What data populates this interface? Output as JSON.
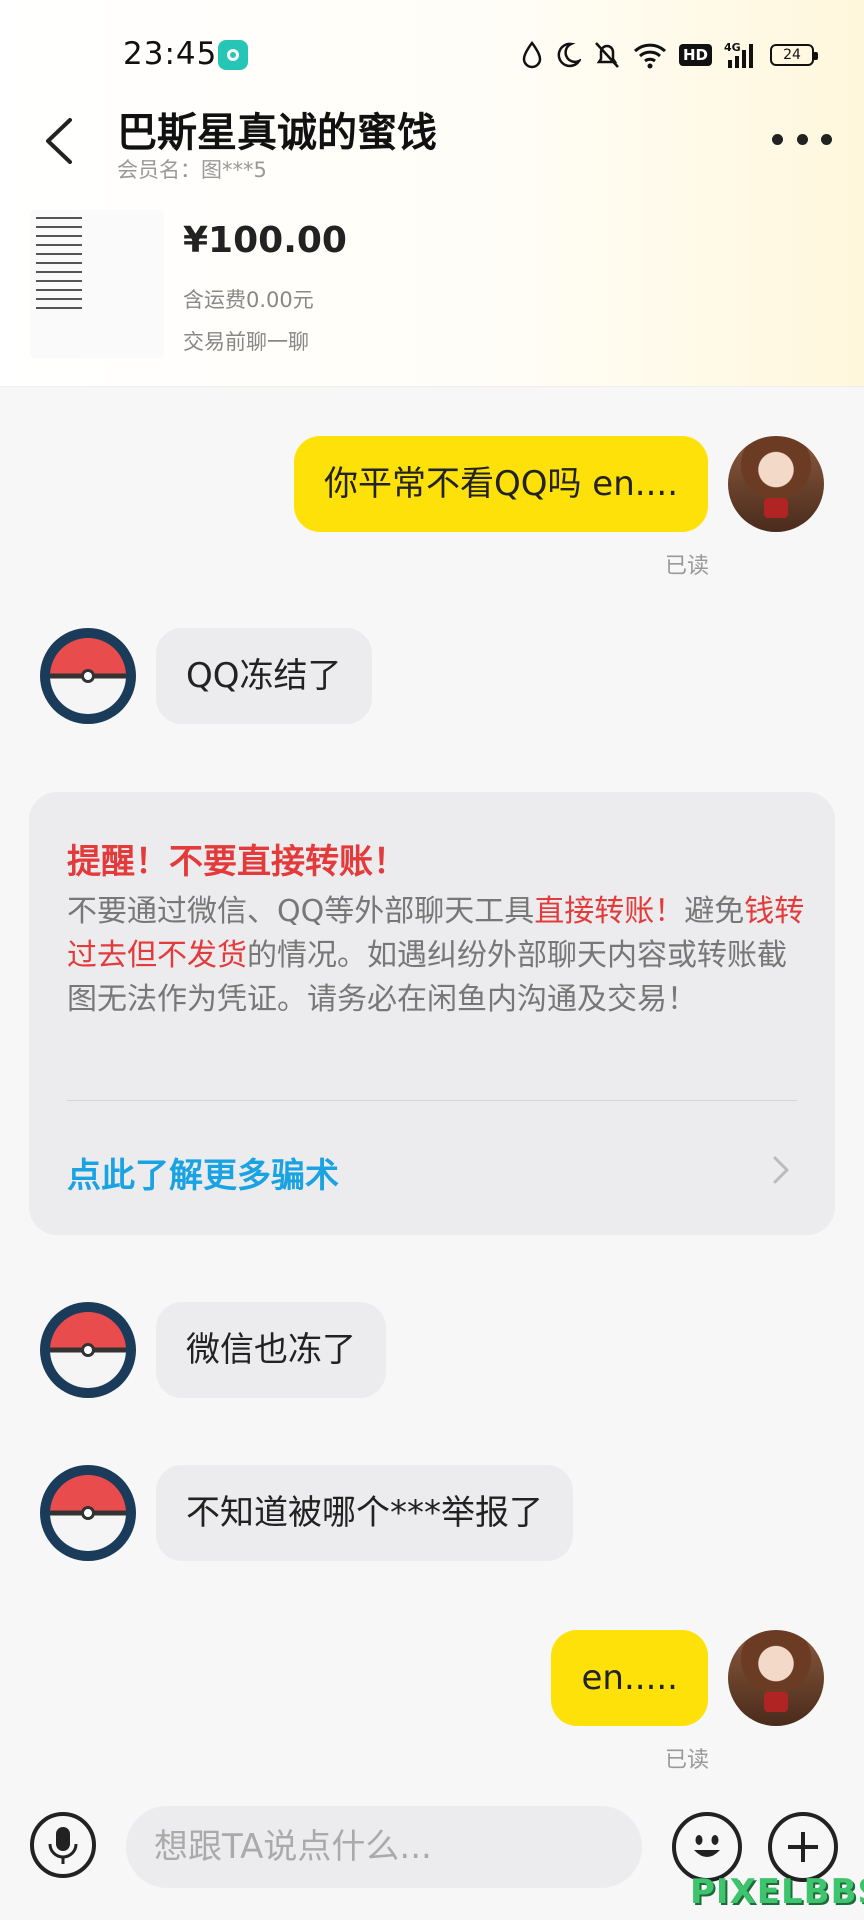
{
  "status_bar": {
    "time": "23:45",
    "hd_label": "HD",
    "network_label": "4G",
    "battery": "24"
  },
  "header": {
    "title": "巴斯星真诚的蜜饯",
    "subtitle": "会员名：图***5"
  },
  "product": {
    "price": "¥100.00",
    "shipping": "含运费0.00元",
    "chat_hint": "交易前聊一聊"
  },
  "messages": [
    {
      "from": "me",
      "text": "你平常不看QQ吗 en....",
      "status": "已读"
    },
    {
      "from": "other",
      "text": "QQ冻结了"
    },
    {
      "from": "other",
      "text": "微信也冻了"
    },
    {
      "from": "other",
      "text": "不知道被哪个***举报了"
    },
    {
      "from": "me",
      "text": "en.....",
      "status": "已读"
    }
  ],
  "notice": {
    "title": "提醒！不要直接转账！",
    "body_1": "不要通过微信、QQ等外部聊天工具",
    "body_red_1": "直接转账！",
    "body_2": "避免",
    "body_red_2": "钱转过去但不发货",
    "body_3": "的情况。如遇纠纷外部聊天内容或转账截图无法作为凭证。请务必在闲鱼内沟通及交易！",
    "link": "点此了解更多骗术"
  },
  "input": {
    "placeholder": "想跟TA说点什么..."
  },
  "watermark": "PIXELBBS",
  "colors": {
    "my_bubble": "#ffe10a",
    "other_bubble": "#ececee",
    "warning_red": "#e33b3b",
    "link_blue": "#1aa3e3"
  }
}
